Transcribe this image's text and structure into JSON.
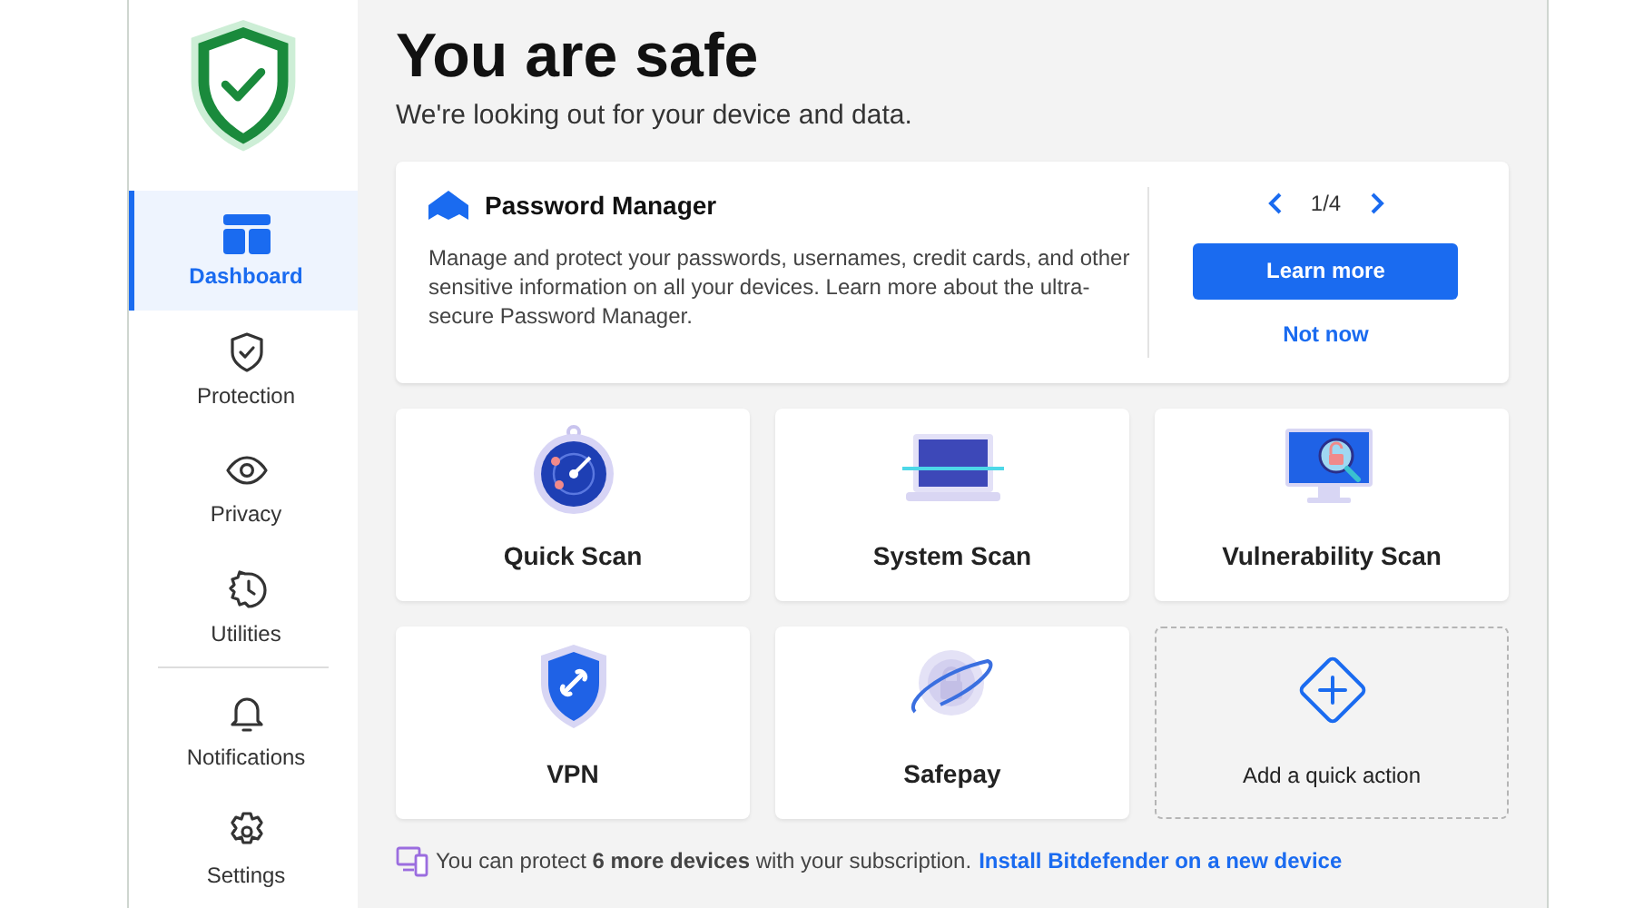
{
  "sidebar": {
    "items": [
      {
        "kind": "dashboard",
        "label": "Dashboard",
        "selected": true
      },
      {
        "kind": "protection",
        "label": "Protection",
        "selected": false
      },
      {
        "kind": "privacy",
        "label": "Privacy",
        "selected": false
      },
      {
        "kind": "utilities",
        "label": "Utilities",
        "selected": false
      }
    ],
    "secondary_items": [
      {
        "kind": "notifications",
        "label": "Notifications",
        "selected": false
      },
      {
        "kind": "settings",
        "label": "Settings",
        "selected": false
      }
    ]
  },
  "header": {
    "title": "You are safe",
    "subtitle": "We're looking out for your device and data."
  },
  "promo": {
    "title": "Password Manager",
    "text": "Manage and protect your passwords, usernames, credit cards, and other sensitive information on all your devices. Learn more about the ultra-secure Password Manager.",
    "pager": "1/4",
    "primary_button": "Learn more",
    "secondary_button": "Not now"
  },
  "quick_actions": [
    {
      "kind": "quick_scan",
      "label": "Quick Scan"
    },
    {
      "kind": "system_scan",
      "label": "System Scan"
    },
    {
      "kind": "vulnerability_scan",
      "label": "Vulnerability Scan"
    },
    {
      "kind": "vpn",
      "label": "VPN"
    },
    {
      "kind": "safepay",
      "label": "Safepay"
    },
    {
      "kind": "add",
      "label": "Add a quick action"
    }
  ],
  "footer": {
    "text": "You can protect **6 more devices** with your subscription.",
    "link": "Install Bitdefender on a new device"
  }
}
